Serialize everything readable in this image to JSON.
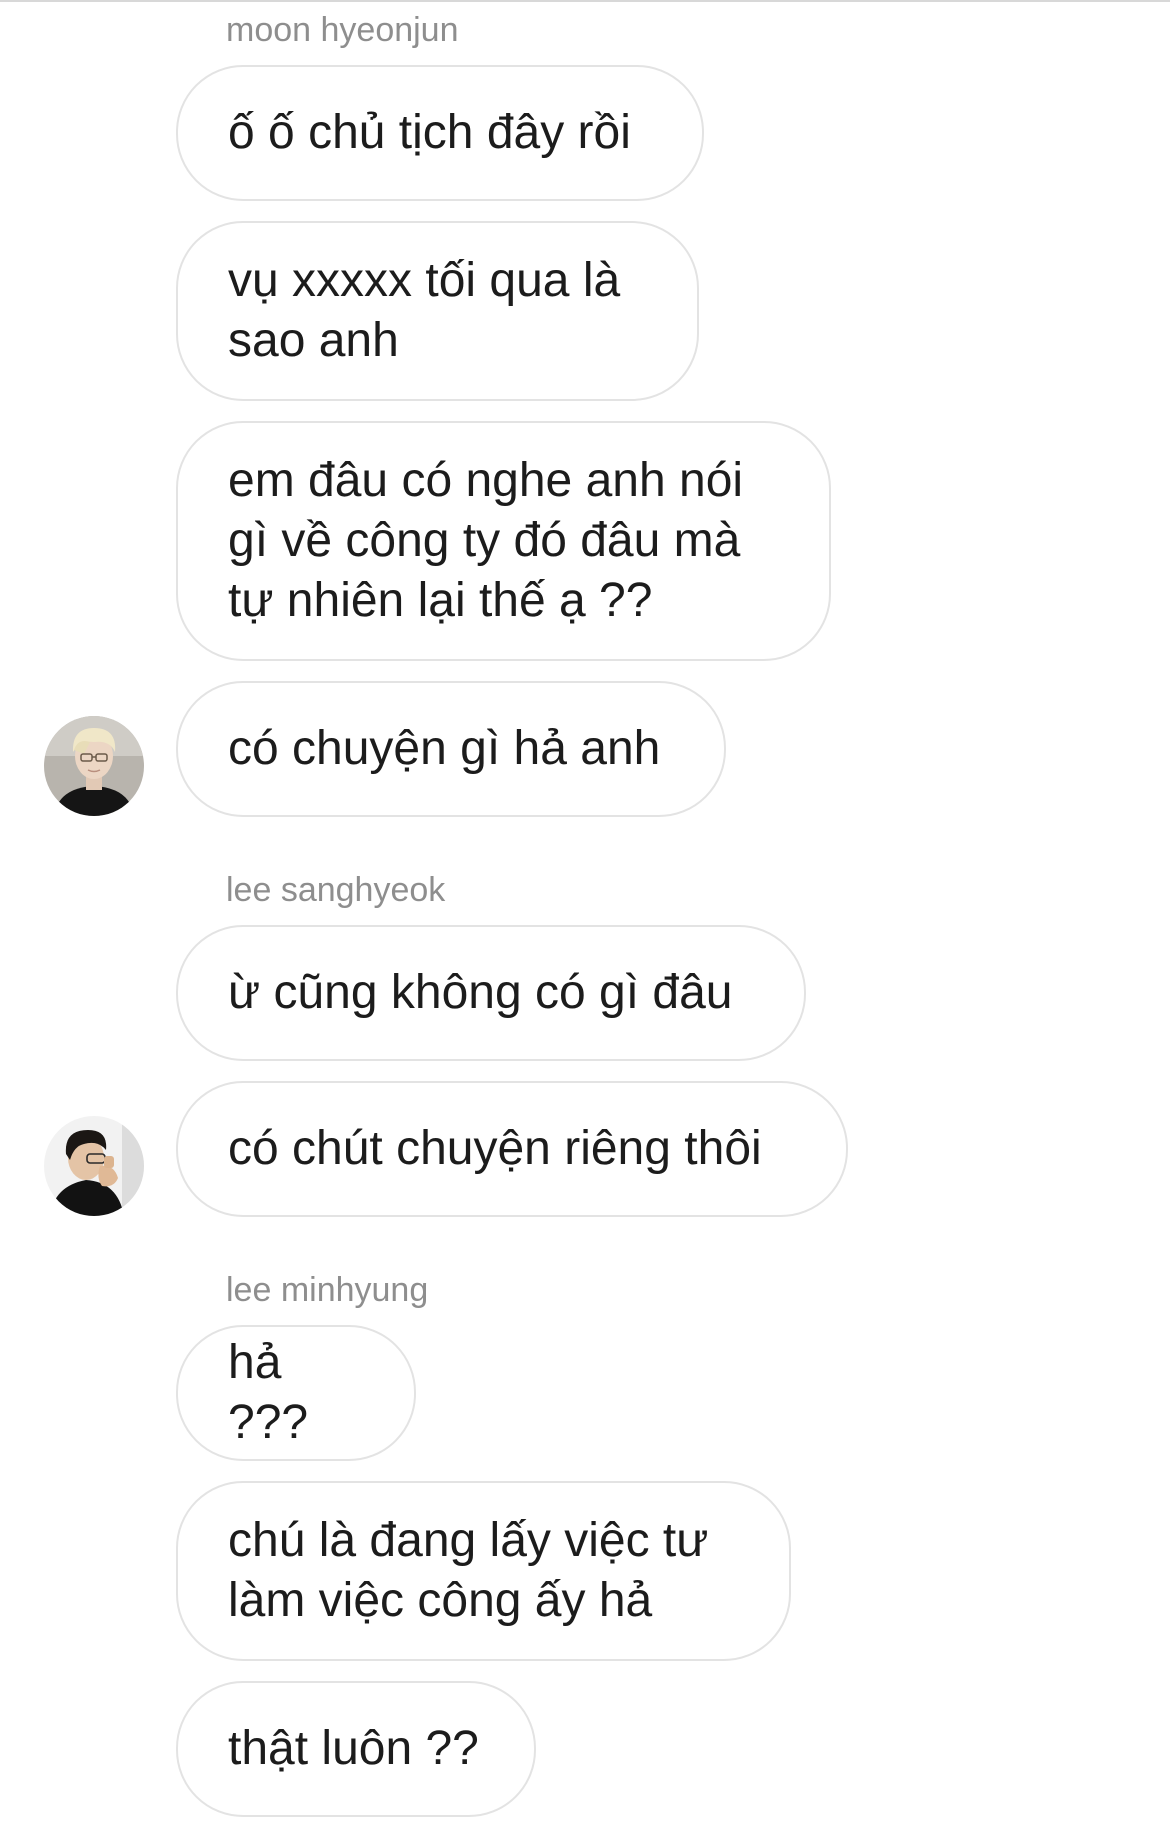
{
  "thread": {
    "groups": [
      {
        "sender": "moon hyeonjun",
        "messages": [
          "ố ố chủ tịch đây rồi",
          "vụ xxxxx tối qua là\nsao anh",
          "em đâu có nghe anh nói\ngì về công ty đó đâu mà\ntự nhiên lại thế ạ ??",
          "có chuyện gì hả anh"
        ],
        "avatar_icon": "avatar-blond-glasses"
      },
      {
        "sender": "lee sanghyeok",
        "messages": [
          "ừ cũng không có gì đâu",
          "có chút chuyện riêng thôi"
        ],
        "avatar_icon": "avatar-dark-hair-hand"
      },
      {
        "sender": "lee minhyung",
        "messages": [
          "hả ???",
          "chú là đang lấy việc tư\nlàm việc công ấy hả",
          "thật luôn ??"
        ]
      }
    ]
  },
  "colors": {
    "bubble_border": "#e3e3e3",
    "sender_name": "#8e8e8e",
    "message_text": "#1c1c1c",
    "background": "#ffffff"
  }
}
